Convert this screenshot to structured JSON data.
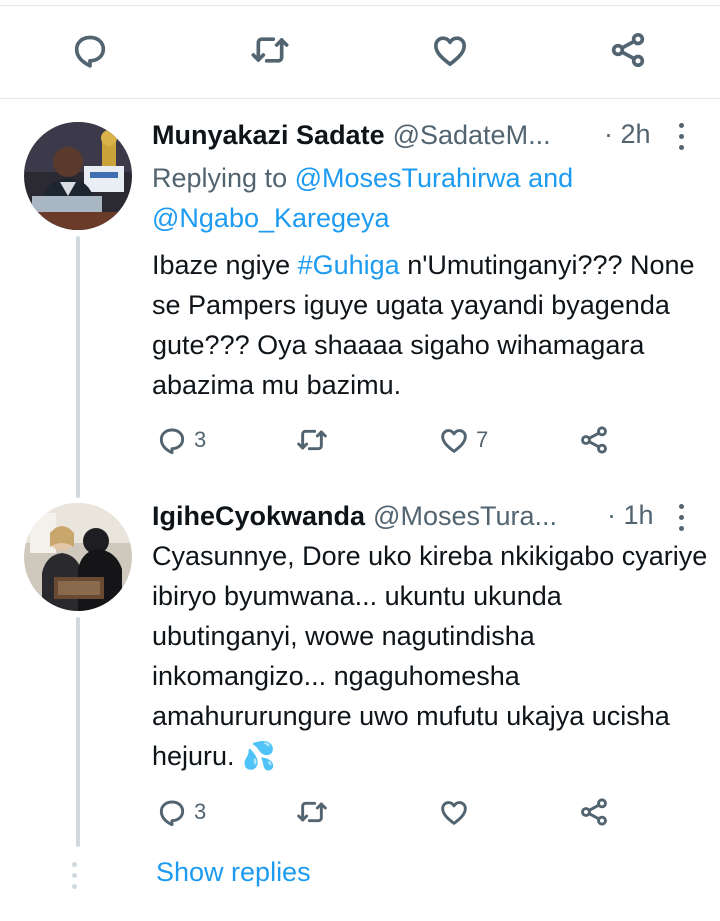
{
  "top_actions": {
    "icons": [
      "reply-icon",
      "retweet-icon",
      "like-icon",
      "share-icon"
    ]
  },
  "tweets": [
    {
      "name": "Munyakazi Sadate",
      "handle": "@SadateM...",
      "time": "· 2h",
      "replying_prefix": "Replying to",
      "replying_to_1": "@MosesTurahirwa",
      "replying_and": "and",
      "replying_to_2": "@Ngabo_Karegeya",
      "text_1": "Ibaze ngiye ",
      "hashtag": "#Guhiga",
      "text_2": " n'Umutinganyi??? None se Pampers iguye ugata yayandi byagenda gute??? Oya shaaaa sigaho wihamagara abazima mu bazimu.",
      "replies": "3",
      "retweets": "",
      "likes": "7"
    },
    {
      "name": "IgiheCyokwanda",
      "handle": "@MosesTura...",
      "time": "· 1h",
      "text": "Cyasunnye, Dore uko kireba nkikigabo cyariye ibiryo byumwana... ukuntu ukunda ubutinganyi, wowe nagutindisha inkomangizo... ngaguhomesha amahururungure  uwo mufutu ukajya ucisha hejuru. 💦",
      "replies": "3",
      "retweets": "",
      "likes": ""
    }
  ],
  "show_replies": "Show replies",
  "colors": {
    "accent": "#1d9bf0",
    "text": "#0f1419",
    "muted": "#536471",
    "divider": "#e6e8ea"
  }
}
